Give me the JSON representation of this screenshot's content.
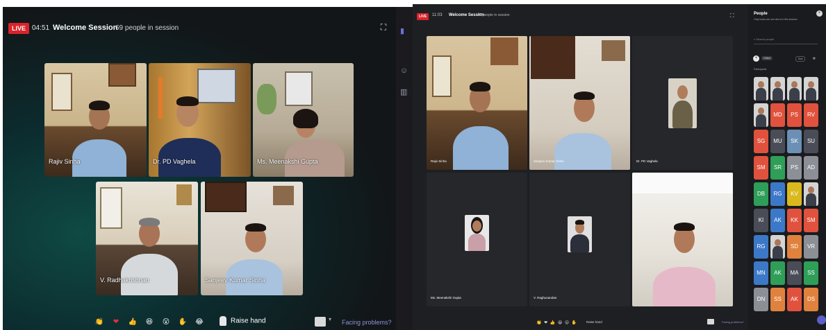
{
  "left": {
    "live_label": "LIVE",
    "elapsed": "04:51",
    "title": "Welcome Session",
    "people_count": "69 people in session",
    "tiles": [
      {
        "name": "Rajiv Sinha"
      },
      {
        "name": "Dr. PD Vaghela"
      },
      {
        "name": "Ms. Meenakshi Gupta"
      },
      {
        "name": "V. Radhakrishnan"
      },
      {
        "name": "Sanjeev Kumar Sinha"
      }
    ],
    "reactions": [
      "👏",
      "❤",
      "👍",
      "😆",
      "😮",
      "✋",
      "😂"
    ],
    "raise_hand": "Raise hand",
    "facing_problems": "Facing problems?"
  },
  "right": {
    "live_label": "LIVE",
    "elapsed": "11:03",
    "title": "Welcome Session",
    "people_count": "77 people in session",
    "tiles": [
      {
        "name": "Rajiv Sinha"
      },
      {
        "name": "Sanjeev Kumar Sinha"
      },
      {
        "name": "Dr. PD Vaghela"
      },
      {
        "name": "Ms. Meenakshi Gupta"
      },
      {
        "name": "V. Raghunandan"
      },
      {
        "name": ""
      }
    ],
    "reactions": "👏 ❤ 👍 😆 😮 ✋",
    "raise_hand": "Raise hand",
    "facing_problems": "Facing problems?",
    "people_panel": {
      "title": "People",
      "subtitle": "Only hosts can see who's in this session",
      "search_placeholder": "Search people",
      "filter_all": "Online",
      "filter_sort": "Sort",
      "section": "Participants",
      "avatars": [
        {
          "type": "img"
        },
        {
          "type": "img"
        },
        {
          "type": "img"
        },
        {
          "type": "img"
        },
        {
          "type": "img"
        },
        {
          "type": "initials",
          "text": "MD",
          "color": "#e0523d"
        },
        {
          "type": "initials",
          "text": "PS",
          "color": "#e0523d"
        },
        {
          "type": "initials",
          "text": "RV",
          "color": "#e0523d"
        },
        {
          "type": "initials",
          "text": "SG",
          "color": "#e0523d"
        },
        {
          "type": "initials",
          "text": "MU",
          "color": "#4a4d57"
        },
        {
          "type": "initials",
          "text": "SK",
          "color": "#6b8fb5"
        },
        {
          "type": "initials",
          "text": "SU",
          "color": "#4a4d57"
        },
        {
          "type": "initials",
          "text": "SM",
          "color": "#e0523d"
        },
        {
          "type": "initials",
          "text": "SR",
          "color": "#2f9e58"
        },
        {
          "type": "initials",
          "text": "PS",
          "color": "#8c8f96"
        },
        {
          "type": "initials",
          "text": "AD",
          "color": "#8c8f96"
        },
        {
          "type": "initials",
          "text": "DB",
          "color": "#2f9e58"
        },
        {
          "type": "initials",
          "text": "RG",
          "color": "#3c78c8"
        },
        {
          "type": "initials",
          "text": "KV",
          "color": "#d9b91e"
        },
        {
          "type": "img"
        },
        {
          "type": "initials",
          "text": "KI",
          "color": "#4a4d57"
        },
        {
          "type": "initials",
          "text": "AK",
          "color": "#3c78c8"
        },
        {
          "type": "initials",
          "text": "KK",
          "color": "#e0523d"
        },
        {
          "type": "initials",
          "text": "SM",
          "color": "#e0523d"
        },
        {
          "type": "initials",
          "text": "RG",
          "color": "#3c78c8"
        },
        {
          "type": "img"
        },
        {
          "type": "initials",
          "text": "SD",
          "color": "#e0823d"
        },
        {
          "type": "initials",
          "text": "VR",
          "color": "#8c8f96"
        },
        {
          "type": "initials",
          "text": "MN",
          "color": "#3c78c8"
        },
        {
          "type": "initials",
          "text": "AK",
          "color": "#2f9e58"
        },
        {
          "type": "initials",
          "text": "MA",
          "color": "#4a4d57"
        },
        {
          "type": "initials",
          "text": "SS",
          "color": "#2f9e58"
        },
        {
          "type": "initials",
          "text": "DN",
          "color": "#8c8f96"
        },
        {
          "type": "initials",
          "text": "SS",
          "color": "#e0823d"
        },
        {
          "type": "initials",
          "text": "AK",
          "color": "#e0523d"
        },
        {
          "type": "initials",
          "text": "DS",
          "color": "#e0823d"
        }
      ]
    }
  }
}
